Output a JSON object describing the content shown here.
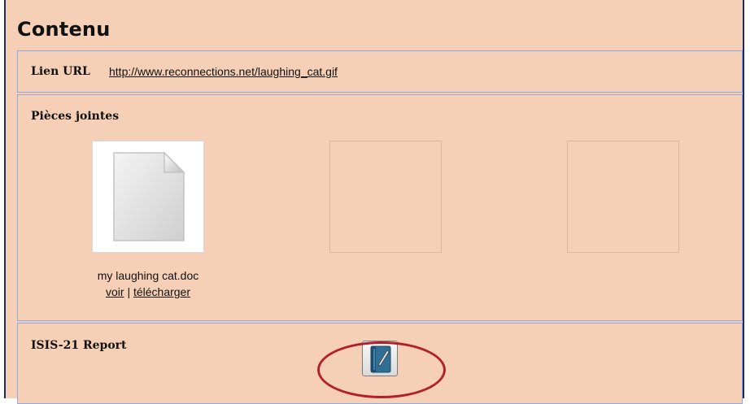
{
  "header": {
    "title": "Contenu"
  },
  "url_section": {
    "label": "Lien URL",
    "link": "http://www.reconnections.net/laughing_cat.gif"
  },
  "attachments_section": {
    "label": "Pièces jointes",
    "items": [
      {
        "filename": "my laughing cat.doc",
        "view_label": "voir",
        "separator": "|",
        "download_label": "télécharger",
        "icon": "document-icon"
      }
    ],
    "empty_slots": 2
  },
  "report_section": {
    "label": "ISIS-21 Report",
    "button_icon": "notebook-pen-icon"
  },
  "colors": {
    "panel_background": "#f5d0b6",
    "section_border": "#8da9e6",
    "outer_border": "#1a2a6c",
    "highlight": "#b3202a"
  }
}
